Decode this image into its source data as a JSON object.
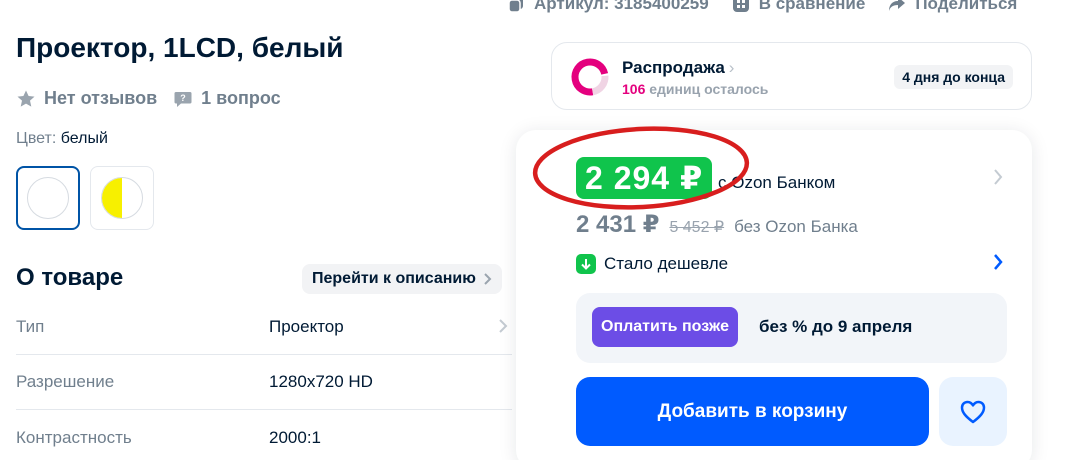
{
  "meta": {
    "article": "Артикул: 3185400259",
    "compare": "В сравнение",
    "share": "Поделиться"
  },
  "product": {
    "title": "Проектор, 1LCD, белый",
    "reviews": "Нет отзывов",
    "questions": "1 вопрос",
    "color_label": "Цвет:",
    "color_value": "белый",
    "swatches": [
      {
        "name": "white",
        "selected": true
      },
      {
        "name": "white-yellow",
        "selected": false
      }
    ]
  },
  "about": {
    "title": "О товаре",
    "goto_label": "Перейти к описанию",
    "specs": [
      {
        "key": "Тип",
        "value": "Проектор"
      },
      {
        "key": "Разрешение",
        "value": "1280x720 HD"
      },
      {
        "key": "Контрастность",
        "value": "2000:1"
      }
    ]
  },
  "sale": {
    "title": "Распродажа",
    "count": "106",
    "count_suffix": "единиц осталось",
    "timer": "4 дня до конца"
  },
  "price": {
    "ozon_price": "2 294 ₽",
    "ozon_label": "с Ozon Банком",
    "regular": "2 431 ₽",
    "old": "5 452 ₽",
    "without_label": "без Ozon Банка",
    "cheaper": "Стало дешевле"
  },
  "pay_later": {
    "button": "Оплатить позже",
    "text": "без % до 9 апреля"
  },
  "actions": {
    "add_to_cart": "Добавить в корзину"
  },
  "colors": {
    "ozon_green": "#10c44c",
    "primary_blue": "#005bff",
    "pay_purple": "#6c4de6",
    "sale_pink": "#e4007e",
    "annotation_red": "#d81e1e"
  }
}
